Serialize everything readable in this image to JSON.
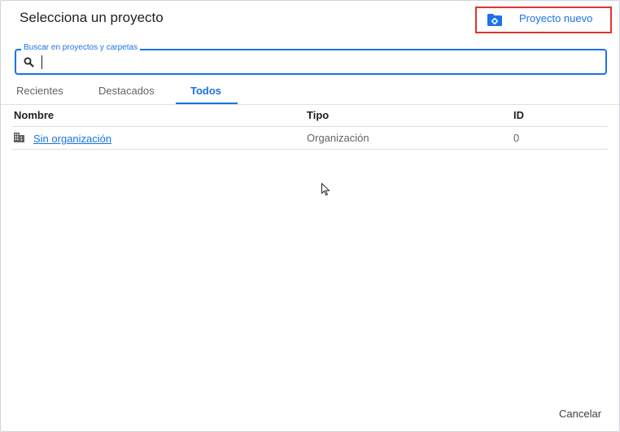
{
  "dialog": {
    "title": "Selecciona un proyecto",
    "new_project_label": "Proyecto nuevo",
    "search": {
      "legend": "Buscar en proyectos y carpetas",
      "value": "",
      "placeholder": ""
    },
    "tabs": [
      {
        "label": "Recientes",
        "active": false
      },
      {
        "label": "Destacados",
        "active": false
      },
      {
        "label": "Todos",
        "active": true
      }
    ],
    "table": {
      "columns": [
        "Nombre",
        "Tipo",
        "ID"
      ],
      "rows": [
        {
          "icon": "building-icon",
          "name": "Sin organización",
          "type": "Organización",
          "id": "0"
        }
      ]
    },
    "cancel_label": "Cancelar"
  },
  "colors": {
    "accent": "#1a73e8",
    "highlight_border": "#e0342b"
  }
}
